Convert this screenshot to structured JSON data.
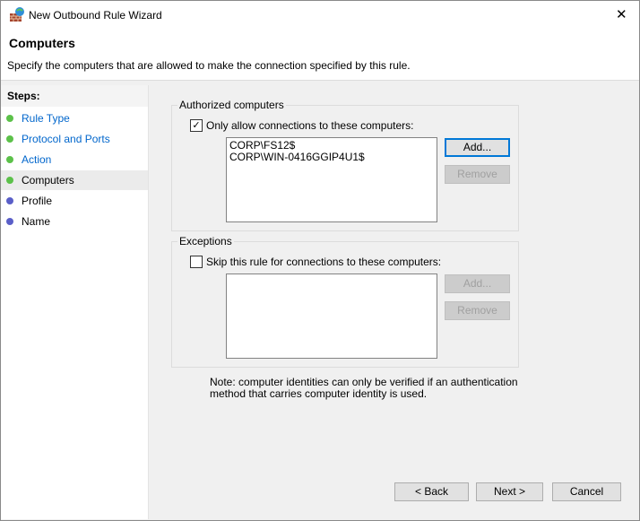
{
  "window": {
    "title": "New Outbound Rule Wizard",
    "close_glyph": "✕"
  },
  "header": {
    "title": "Computers",
    "subtitle": "Specify the computers that are allowed to make the connection specified by this rule."
  },
  "steps": {
    "heading": "Steps:",
    "items": [
      {
        "label": "Rule Type",
        "color": "#5cc14a"
      },
      {
        "label": "Protocol and Ports",
        "color": "#5cc14a"
      },
      {
        "label": "Action",
        "color": "#5cc14a"
      },
      {
        "label": "Computers",
        "color": "#5cc14a"
      },
      {
        "label": "Profile",
        "color": "#5a5fc8"
      },
      {
        "label": "Name",
        "color": "#5a5fc8"
      }
    ]
  },
  "authorized": {
    "legend": "Authorized computers",
    "checkbox_label": "Only allow connections to these computers:",
    "checked": true,
    "computers": [
      "CORP\\FS12$",
      "CORP\\WIN-0416GGIP4U1$"
    ],
    "add": "Add...",
    "remove": "Remove"
  },
  "exceptions": {
    "legend": "Exceptions",
    "checkbox_label": "Skip this rule for connections to these computers:",
    "checked": false,
    "add": "Add...",
    "remove": "Remove"
  },
  "note": {
    "line1": "Note: computer identities can only be verified if an authentication",
    "line2": "method that carries computer identity is used."
  },
  "footer": {
    "back": "< Back",
    "next": "Next >",
    "cancel": "Cancel"
  }
}
